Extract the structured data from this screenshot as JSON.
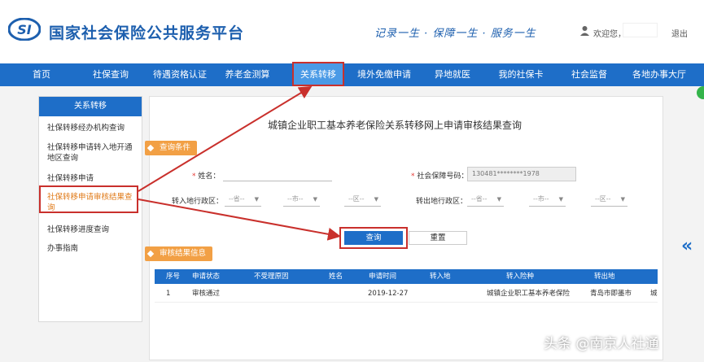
{
  "header": {
    "site_title": "国家社会保险公共服务平台",
    "slogan": "记录一生 · 保障一生 · 服务一生",
    "welcome": "欢迎您，",
    "logout": "退出",
    "logo_text": "SI"
  },
  "nav": {
    "items": [
      {
        "label": "首页"
      },
      {
        "label": "社保查询"
      },
      {
        "label": "待遇资格认证"
      },
      {
        "label": "养老金测算"
      },
      {
        "label": "关系转移"
      },
      {
        "label": "境外免缴申请"
      },
      {
        "label": "异地就医"
      },
      {
        "label": "我的社保卡"
      },
      {
        "label": "社会监督"
      },
      {
        "label": "各地办事大厅"
      }
    ],
    "active": "关系转移"
  },
  "sidebar": {
    "title": "关系转移",
    "items": [
      {
        "label": "社保转移经办机构查询"
      },
      {
        "label": "社保转移申请转入地开通地区查询"
      },
      {
        "label": "社保转移申请"
      },
      {
        "label": "社保转移申请审核结果查询"
      },
      {
        "label": "社保转移进度查询"
      },
      {
        "label": "办事指南"
      }
    ],
    "active": "社保转移申请审核结果查询"
  },
  "main": {
    "title": "城镇企业职工基本养老保险关系转移网上申请审核结果查询",
    "query_section": "查询条件",
    "name_label": "姓名：",
    "id_label": "社会保障号码：",
    "id_value": "130481********1978",
    "in_region_label": "转入地行政区：",
    "out_region_label": "转出地行政区：",
    "select_province": "--省--",
    "select_city": "--市--",
    "select_district": "--区--",
    "required_mark": "*",
    "query_button": "查询",
    "reset_button": "重置",
    "result_section": "审核结果信息"
  },
  "table": {
    "headers": [
      "序号",
      "申请状态",
      "不受理原因",
      "姓名",
      "申请时间",
      "转入地",
      "转入险种",
      "转出地"
    ],
    "rows": [
      {
        "index": "1",
        "status": "审核通过",
        "reason": "",
        "name": "",
        "date": "2019-12-27",
        "in_place": "",
        "insurance": "城镇企业职工基本养老保险",
        "out_place": "青岛市即墨市",
        "extra": "城"
      }
    ]
  },
  "colors": {
    "primary": "#1e6ec8",
    "nav_active": "#4a9ae6",
    "accent_orange": "#f2a045",
    "highlight_red": "#c9302c"
  },
  "watermark": "头条 @南京人社通",
  "side_arrow": "«"
}
